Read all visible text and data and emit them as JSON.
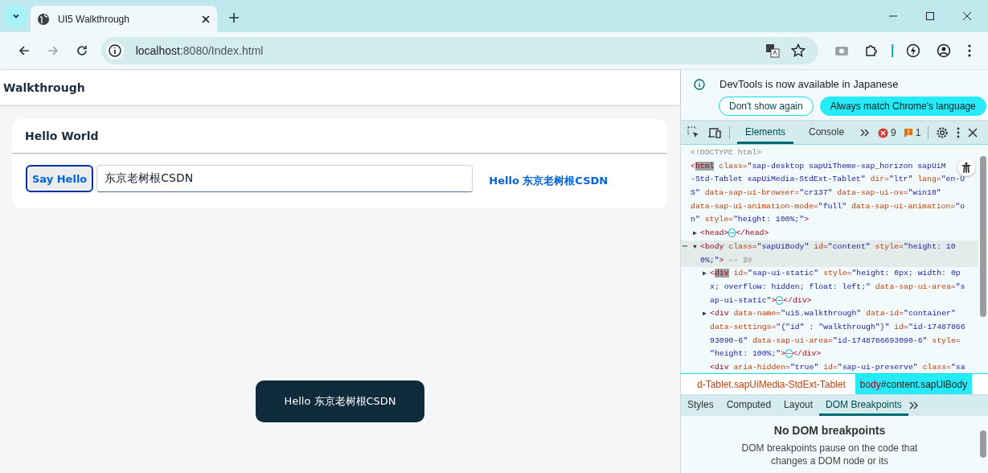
{
  "browser": {
    "tab_title": "UI5 Walkthrough",
    "url_host": "localhost",
    "url_path": ":8080/Index.html"
  },
  "app": {
    "title": "Walkthrough",
    "panel_title": "Hello World",
    "button": "Say Hello",
    "input_value": "东京老树根CSDN",
    "greeting": "Hello 东京老树根CSDN",
    "toast": "Hello 东京老树根CSDN"
  },
  "devtools": {
    "info": "DevTools is now available in Japanese",
    "info_buttons": [
      {
        "label": "Don't show again",
        "kind": "outline"
      },
      {
        "label": "Always match Chrome's language",
        "kind": "filled"
      }
    ],
    "tabs": [
      {
        "label": "Elements",
        "selected": true
      },
      {
        "label": "Console",
        "selected": false
      }
    ],
    "errors": "9",
    "warnings": "1",
    "dom_tree": [
      {
        "selected": false,
        "lines": [
          [
            {
              "kind": "comment",
              "text": "<!DOCTYPE html>"
            }
          ]
        ]
      },
      {
        "selected": false,
        "lines": [
          [
            {
              "kind": "punct",
              "text": "<"
            },
            {
              "kind": "tag_marked",
              "text": "html"
            },
            {
              "kind": "attr",
              "text": " class"
            },
            {
              "kind": "punct",
              "text": "="
            },
            {
              "kind": "value",
              "text": "\"sap-desktop sapUiTheme-sap_horizon sapUiM"
            }
          ],
          [
            {
              "kind": "value",
              "text": "-Std-Tablet sapUiMedia-StdExt-Tablet\""
            },
            {
              "kind": "attr",
              "text": " dir"
            },
            {
              "kind": "punct",
              "text": "="
            },
            {
              "kind": "value",
              "text": "\"ltr\""
            },
            {
              "kind": "attr",
              "text": " lang"
            },
            {
              "kind": "punct",
              "text": "="
            },
            {
              "kind": "value",
              "text": "\"en-U"
            }
          ],
          [
            {
              "kind": "value",
              "text": "S\""
            },
            {
              "kind": "attr",
              "text": " data-sap-ui-browser"
            },
            {
              "kind": "punct",
              "text": "="
            },
            {
              "kind": "value",
              "text": "\"cr137\""
            },
            {
              "kind": "attr",
              "text": " data-sap-ui-os"
            },
            {
              "kind": "punct",
              "text": "="
            },
            {
              "kind": "value",
              "text": "\"win10\""
            }
          ],
          [
            {
              "kind": "attr",
              "text": "data-sap-ui-animation-mode"
            },
            {
              "kind": "punct",
              "text": "="
            },
            {
              "kind": "value",
              "text": "\"full\""
            },
            {
              "kind": "attr",
              "text": " data-sap-ui-animation"
            },
            {
              "kind": "punct",
              "text": "="
            },
            {
              "kind": "value",
              "text": "\"o"
            }
          ],
          [
            {
              "kind": "value",
              "text": "n\""
            },
            {
              "kind": "attr",
              "text": " style"
            },
            {
              "kind": "punct",
              "text": "="
            },
            {
              "kind": "value",
              "text": "\"height: 100%;\""
            },
            {
              "kind": "punct",
              "text": ">"
            }
          ]
        ],
        "children": [
          {
            "selected": false,
            "toggle": "▶",
            "lines": [
              [
                {
                  "kind": "punct",
                  "text": "<"
                },
                {
                  "kind": "tag",
                  "text": "head"
                },
                {
                  "kind": "punct",
                  "text": ">"
                },
                {
                  "kind": "collapsed",
                  "text": "⋯"
                },
                {
                  "kind": "punct",
                  "text": "</"
                },
                {
                  "kind": "tag",
                  "text": "head"
                },
                {
                  "kind": "punct",
                  "text": ">"
                }
              ]
            ]
          },
          {
            "selected": true,
            "gutter": "⋯",
            "toggle": "▼",
            "lines": [
              [
                {
                  "kind": "punct",
                  "text": "<"
                },
                {
                  "kind": "tag",
                  "text": "body"
                },
                {
                  "kind": "attr",
                  "text": " class"
                },
                {
                  "kind": "punct",
                  "text": "="
                },
                {
                  "kind": "value",
                  "text": "\"sapUiBody\""
                },
                {
                  "kind": "attr",
                  "text": " id"
                },
                {
                  "kind": "punct",
                  "text": "="
                },
                {
                  "kind": "value",
                  "text": "\"content\""
                },
                {
                  "kind": "attr",
                  "text": " style"
                },
                {
                  "kind": "punct",
                  "text": "="
                },
                {
                  "kind": "value",
                  "text": "\"height: 10"
                }
              ],
              [
                {
                  "kind": "value",
                  "text": "0%;\""
                },
                {
                  "kind": "punct",
                  "text": ">"
                },
                {
                  "kind": "console_ref",
                  "text": " == $0"
                }
              ]
            ],
            "children": [
              {
                "selected": false,
                "toggle": "▶",
                "lines": [
                  [
                    {
                      "kind": "punct",
                      "text": "<"
                    },
                    {
                      "kind": "tag_marked",
                      "text": "div"
                    },
                    {
                      "kind": "attr",
                      "text": " id"
                    },
                    {
                      "kind": "punct",
                      "text": "="
                    },
                    {
                      "kind": "value",
                      "text": "\"sap-ui-static\""
                    },
                    {
                      "kind": "attr",
                      "text": " style"
                    },
                    {
                      "kind": "punct",
                      "text": "="
                    },
                    {
                      "kind": "value",
                      "text": "\"height: 0px; width: 0p"
                    }
                  ],
                  [
                    {
                      "kind": "value",
                      "text": "x; overflow: hidden; float: left;\""
                    },
                    {
                      "kind": "attr",
                      "text": " data-sap-ui-area"
                    },
                    {
                      "kind": "punct",
                      "text": "="
                    },
                    {
                      "kind": "value",
                      "text": "\"s"
                    }
                  ],
                  [
                    {
                      "kind": "value",
                      "text": "ap-ui-static\""
                    },
                    {
                      "kind": "punct",
                      "text": ">"
                    },
                    {
                      "kind": "collapsed",
                      "text": "⋯"
                    },
                    {
                      "kind": "punct",
                      "text": "</"
                    },
                    {
                      "kind": "tag",
                      "text": "div"
                    },
                    {
                      "kind": "punct",
                      "text": ">"
                    }
                  ]
                ]
              },
              {
                "selected": false,
                "toggle": "▶",
                "lines": [
                  [
                    {
                      "kind": "punct",
                      "text": "<"
                    },
                    {
                      "kind": "tag",
                      "text": "div"
                    },
                    {
                      "kind": "attr",
                      "text": " data-name"
                    },
                    {
                      "kind": "punct",
                      "text": "="
                    },
                    {
                      "kind": "value",
                      "text": "\"ui5.walkthrough\""
                    },
                    {
                      "kind": "attr",
                      "text": " data-id"
                    },
                    {
                      "kind": "punct",
                      "text": "="
                    },
                    {
                      "kind": "value",
                      "text": "\"container\""
                    }
                  ],
                  [
                    {
                      "kind": "attr",
                      "text": "data-settings"
                    },
                    {
                      "kind": "punct",
                      "text": "="
                    },
                    {
                      "kind": "value",
                      "text": "\"{\"id\" : \"walkthrough\"}\""
                    },
                    {
                      "kind": "attr",
                      "text": " id"
                    },
                    {
                      "kind": "punct",
                      "text": "="
                    },
                    {
                      "kind": "value",
                      "text": "\"id-17487866"
                    }
                  ],
                  [
                    {
                      "kind": "value",
                      "text": "93090-6\""
                    },
                    {
                      "kind": "attr",
                      "text": " data-sap-ui-area"
                    },
                    {
                      "kind": "punct",
                      "text": "="
                    },
                    {
                      "kind": "value",
                      "text": "\"id-1748786693090-6\""
                    },
                    {
                      "kind": "attr",
                      "text": " style"
                    },
                    {
                      "kind": "punct",
                      "text": "="
                    }
                  ],
                  [
                    {
                      "kind": "value",
                      "text": "\"height: 100%;\""
                    },
                    {
                      "kind": "punct",
                      "text": ">"
                    },
                    {
                      "kind": "collapsed",
                      "text": "⋯"
                    },
                    {
                      "kind": "punct",
                      "text": "</"
                    },
                    {
                      "kind": "tag",
                      "text": "div"
                    },
                    {
                      "kind": "punct",
                      "text": ">"
                    }
                  ]
                ]
              },
              {
                "selected": false,
                "lines": [
                  [
                    {
                      "kind": "punct",
                      "text": "<"
                    },
                    {
                      "kind": "tag",
                      "text": "div"
                    },
                    {
                      "kind": "attr",
                      "text": " aria-hidden"
                    },
                    {
                      "kind": "punct",
                      "text": "="
                    },
                    {
                      "kind": "value",
                      "text": "\"true\""
                    },
                    {
                      "kind": "attr",
                      "text": " id"
                    },
                    {
                      "kind": "punct",
                      "text": "="
                    },
                    {
                      "kind": "value",
                      "text": "\"sap-ui-preserve\""
                    },
                    {
                      "kind": "attr",
                      "text": " class"
                    },
                    {
                      "kind": "punct",
                      "text": "="
                    },
                    {
                      "kind": "value",
                      "text": "\"sa"
                    }
                  ]
                ]
              }
            ]
          }
        ]
      }
    ],
    "breadcrumbs": [
      {
        "label": "d-Tablet.sapUiMedia-StdExt-Tablet",
        "selected": false
      },
      {
        "tag": "body",
        "label": "#content.sapUiBody",
        "selected": true
      }
    ],
    "subtabs": [
      {
        "label": "Styles",
        "selected": false
      },
      {
        "label": "Computed",
        "selected": false
      },
      {
        "label": "Layout",
        "selected": false
      },
      {
        "label": "DOM Breakpoints",
        "selected": true
      }
    ],
    "empty_title": "No DOM breakpoints",
    "empty_text": "DOM breakpoints pause on the code that changes a DOM node or its"
  }
}
